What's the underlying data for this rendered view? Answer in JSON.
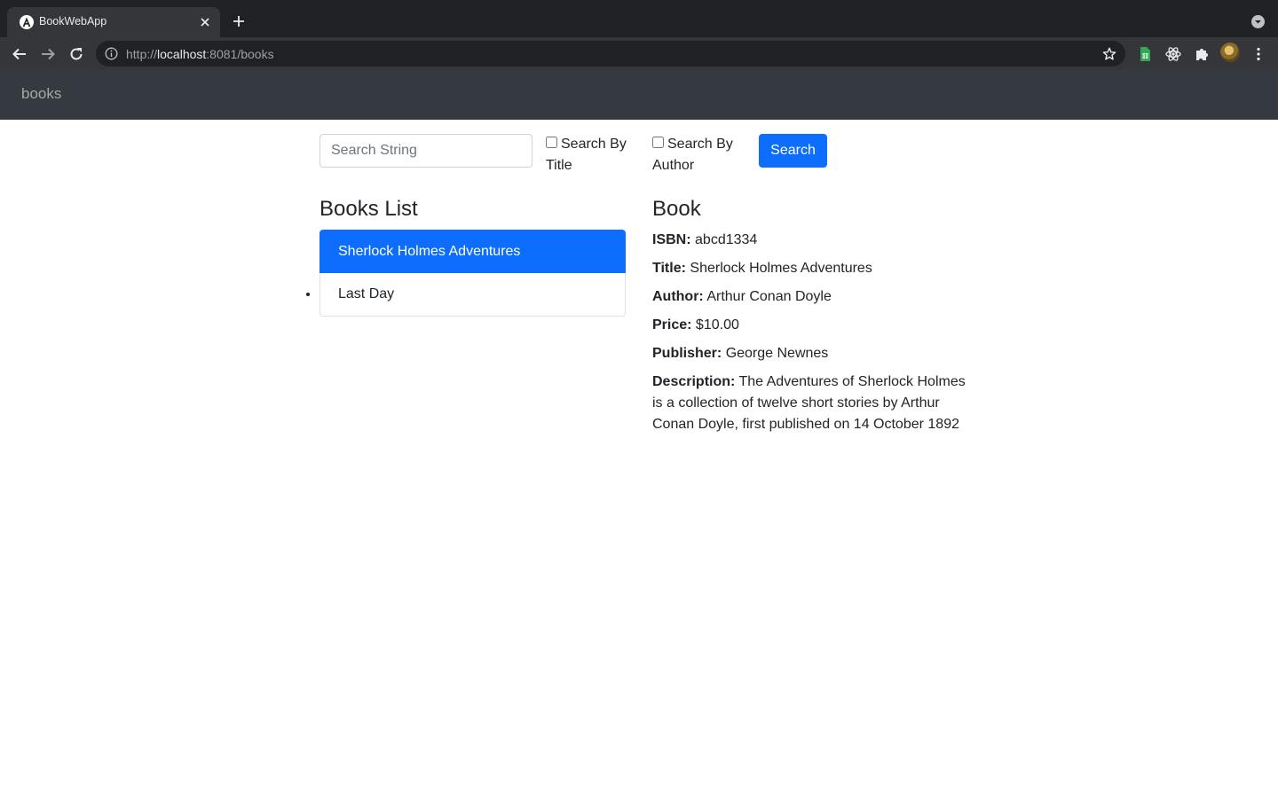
{
  "browser": {
    "tab_title": "BookWebApp",
    "url_scheme": "http://",
    "url_host": "localhost",
    "url_path": ":8081/books"
  },
  "app": {
    "brand": "books",
    "search": {
      "placeholder": "Search String",
      "by_title_label": "Search By Title",
      "by_author_label": "Search By Author",
      "button_label": "Search"
    },
    "list": {
      "heading": "Books List",
      "items": [
        {
          "label": "Sherlock Holmes Adventures",
          "active": true
        },
        {
          "label": "Last Day",
          "active": false
        }
      ]
    },
    "detail": {
      "heading": "Book",
      "fields": [
        {
          "label": "ISBN:",
          "value": "abcd1334"
        },
        {
          "label": "Title:",
          "value": "Sherlock Holmes Adventures"
        },
        {
          "label": "Author:",
          "value": "Arthur Conan Doyle"
        },
        {
          "label": "Price:",
          "value": "$10.00"
        },
        {
          "label": "Publisher:",
          "value": "George Newnes"
        },
        {
          "label": "Description:",
          "value": "The Adventures of Sherlock Holmes is a collection of twelve short stories by Arthur Conan Doyle, first published on 14 October 1892"
        }
      ]
    }
  },
  "colors": {
    "primary": "#0d6efd",
    "navbar": "#343a40",
    "chrome_dark": "#202124",
    "chrome_toolbar": "#35363a"
  }
}
